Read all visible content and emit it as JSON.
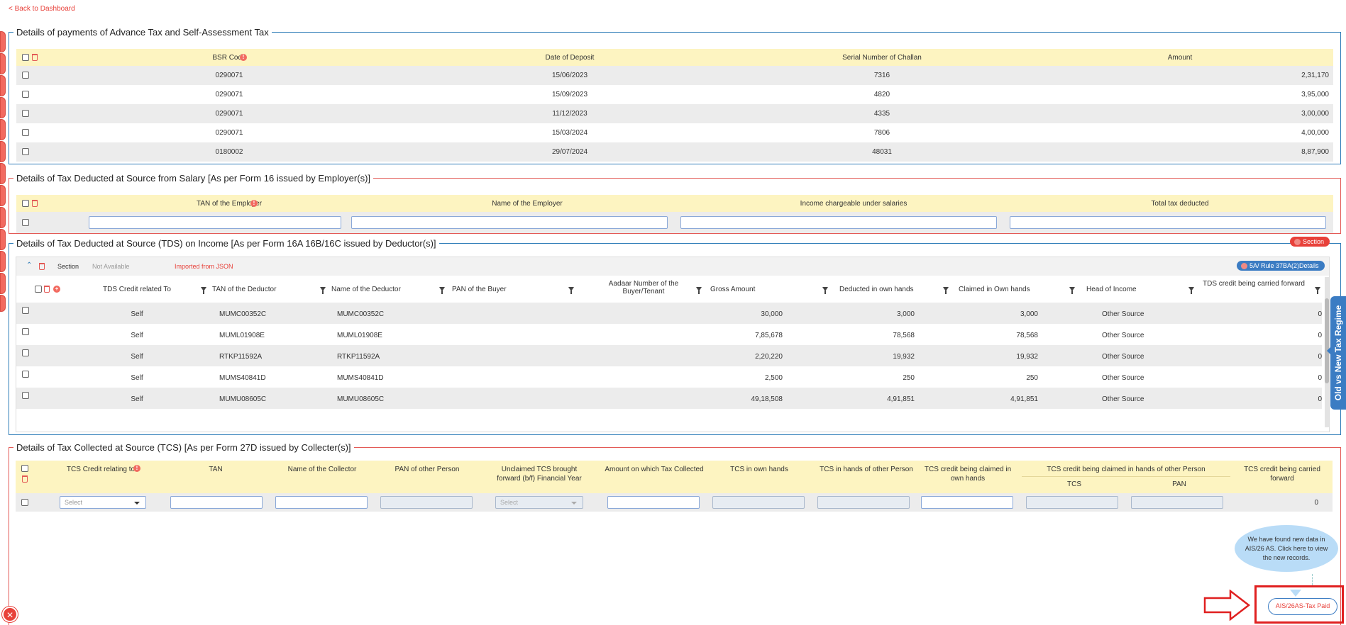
{
  "nav": {
    "back": "< Back to Dashboard"
  },
  "advance_tax": {
    "title": "Details of payments of Advance Tax and Self-Assessment Tax",
    "columns": [
      "BSR Code",
      "Date of Deposit",
      "Serial Number of Challan",
      "Amount"
    ],
    "rows": [
      [
        "0290071",
        "15/06/2023",
        "7316",
        "2,31,170"
      ],
      [
        "0290071",
        "15/09/2023",
        "4820",
        "3,95,000"
      ],
      [
        "0290071",
        "11/12/2023",
        "4335",
        "3,00,000"
      ],
      [
        "0290071",
        "15/03/2024",
        "7806",
        "4,00,000"
      ],
      [
        "0180002",
        "29/07/2024",
        "48031",
        "8,87,900"
      ]
    ]
  },
  "tds_salary": {
    "title": "Details of Tax Deducted at Source from Salary [As per Form 16 issued by Employer(s)]",
    "columns": [
      "TAN of the Employer",
      "Name of the Employer",
      "Income chargeable under salaries",
      "Total tax deducted"
    ]
  },
  "tds_income": {
    "title": "Details of Tax Deducted at Source (TDS) on Income [As per Form 16A 16B/16C issued by Deductor(s)]",
    "section_button": "Section",
    "section_label": "Section",
    "section_value": "Not Available",
    "import_note": "Imported from JSON",
    "rule_button": "5A/ Rule 37BA(2)Details",
    "columns": [
      "TDS Credit related To",
      "TAN of the Deductor",
      "Name of the Deductor",
      "PAN of the Buyer",
      "Aadaar Number of the Buyer/Tenant",
      "Gross Amount",
      "Deducted in own hands",
      "Claimed in Own hands",
      "Head of Income",
      "TDS credit being carried forward"
    ],
    "rows": [
      [
        "Self",
        "MUMC00352C",
        "MUMC00352C",
        "",
        "",
        "30,000",
        "3,000",
        "3,000",
        "Other Source",
        "0"
      ],
      [
        "Self",
        "MUML01908E",
        "MUML01908E",
        "",
        "",
        "7,85,678",
        "78,568",
        "78,568",
        "Other Source",
        "0"
      ],
      [
        "Self",
        "RTKP11592A",
        "RTKP11592A",
        "",
        "",
        "2,20,220",
        "19,932",
        "19,932",
        "Other Source",
        "0"
      ],
      [
        "Self",
        "MUMS40841D",
        "MUMS40841D",
        "",
        "",
        "2,500",
        "250",
        "250",
        "Other Source",
        "0"
      ],
      [
        "Self",
        "MUMU08605C",
        "MUMU08605C",
        "",
        "",
        "49,18,508",
        "4,91,851",
        "4,91,851",
        "Other Source",
        "0"
      ]
    ]
  },
  "tcs": {
    "title": "Details of Tax Collected at Source (TCS) [As per Form 27D issued by Collecter(s)]",
    "columns": [
      "TCS Credit relating to",
      "TAN",
      "Name of the Collector",
      "PAN of other Person",
      "Unclaimed TCS brought forward (b/f) Financial Year",
      "Amount on which Tax Collected",
      "TCS in own hands",
      "TCS in hands of other Person",
      "TCS credit being claimed in own hands",
      "TCS credit being claimed in hands of other Person",
      "TCS credit being carried forward"
    ],
    "sub_columns": [
      "TCS",
      "PAN"
    ],
    "select_placeholder": "Select",
    "select_placeholder_2": "Select",
    "carried_forward_value": "0"
  },
  "regime_tab": "Old vs New Tax Regime",
  "ais_bubble": "We have found new data in AIS/26 AS. Click here to view the new records.",
  "ais_button": "AIS/26AS-Tax Paid",
  "colors": {
    "accent_red": "#e8413a",
    "accent_blue": "#3b7cc3",
    "header_yellow": "#fdf4c1"
  }
}
